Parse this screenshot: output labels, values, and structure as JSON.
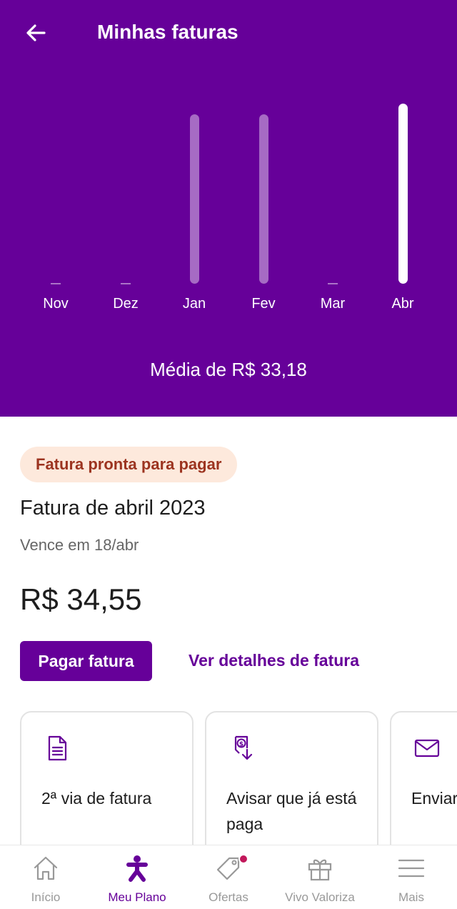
{
  "header": {
    "title": "Minhas faturas"
  },
  "chart_data": {
    "type": "bar",
    "categories": [
      "Nov",
      "Dez",
      "Jan",
      "Fev",
      "Mar",
      "Abr"
    ],
    "values": [
      0,
      0,
      32.5,
      32.5,
      0,
      34.55
    ],
    "highlighted": "Abr",
    "average_label": "Média de R$ 33,18",
    "ylim": [
      0,
      34.55
    ],
    "colors": {
      "background": "#660099",
      "bar": "#b07ac8",
      "active_bar": "#ffffff"
    }
  },
  "invoice": {
    "status_badge": "Fatura pronta para pagar",
    "title": "Fatura de abril 2023",
    "due": "Vence em 18/abr",
    "amount": "R$ 34,55",
    "pay_button": "Pagar fatura",
    "details_link": "Ver detalhes de fatura"
  },
  "cards": [
    {
      "label": "2ª via de fatura",
      "icon": "document-icon"
    },
    {
      "label": "Avisar que já está paga",
      "icon": "payment-notice-icon"
    },
    {
      "label": "Enviar e-mail",
      "icon": "mail-icon"
    }
  ],
  "bottom_nav": [
    {
      "label": "Início",
      "icon": "home-icon"
    },
    {
      "label": "Meu Plano",
      "icon": "vivo-person-icon",
      "active": true
    },
    {
      "label": "Ofertas",
      "icon": "tag-icon",
      "badge": true
    },
    {
      "label": "Vivo Valoriza",
      "icon": "gift-icon"
    },
    {
      "label": "Mais",
      "icon": "menu-icon"
    }
  ],
  "colors": {
    "brand": "#660099",
    "badge_bg": "#fde9dc",
    "badge_text": "#9c3420",
    "notification": "#c2185b"
  }
}
